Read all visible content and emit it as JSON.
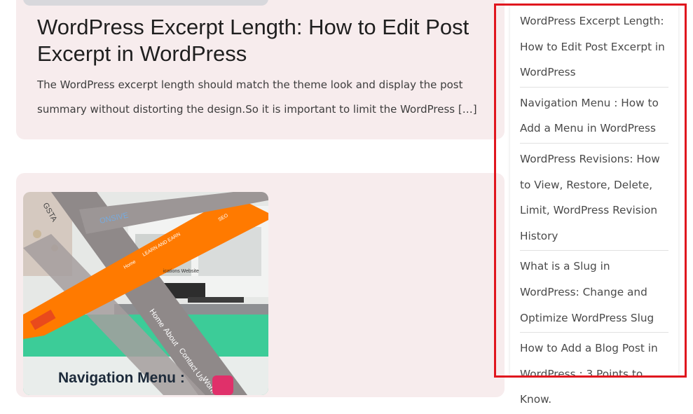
{
  "posts": [
    {
      "title": "WordPress Excerpt Length: How to Edit Post Excerpt in WordPress",
      "excerpt": "The WordPress excerpt length should match the theme look and display the post summary without distorting the design.So it is important to limit the WordPress […]"
    },
    {
      "image_caption": "Navigation Menu :",
      "image_text": {
        "brand": "GSTA",
        "banner_home": "Home",
        "banner_learn": "LEARN AND EARN",
        "banner_seo": "SEO",
        "diagonal_menu": [
          "Home",
          "About",
          "Contact Us",
          "Work"
        ],
        "site_word": "ications Website",
        "partial_word": "ONSIVE"
      }
    }
  ],
  "sidebar": {
    "recent_posts": [
      {
        "label": "WordPress Excerpt Length: How to Edit Post Excerpt in WordPress"
      },
      {
        "label": "Navigation Menu : How to Add a Menu in WordPress"
      },
      {
        "label": "WordPress Revisions: How to View, Restore, Delete, Limit, WordPress Revision History"
      },
      {
        "label": "What is a Slug in WordPress: Change and Optimize WordPress Slug"
      },
      {
        "label": "How to Add a Blog Post in WordPress : 3 Points to Know."
      }
    ]
  },
  "colors": {
    "card_background": "#f7eced",
    "highlight_border": "#e0161e",
    "banner_orange": "#ff7a00",
    "banner_gray": "#9a9494"
  }
}
